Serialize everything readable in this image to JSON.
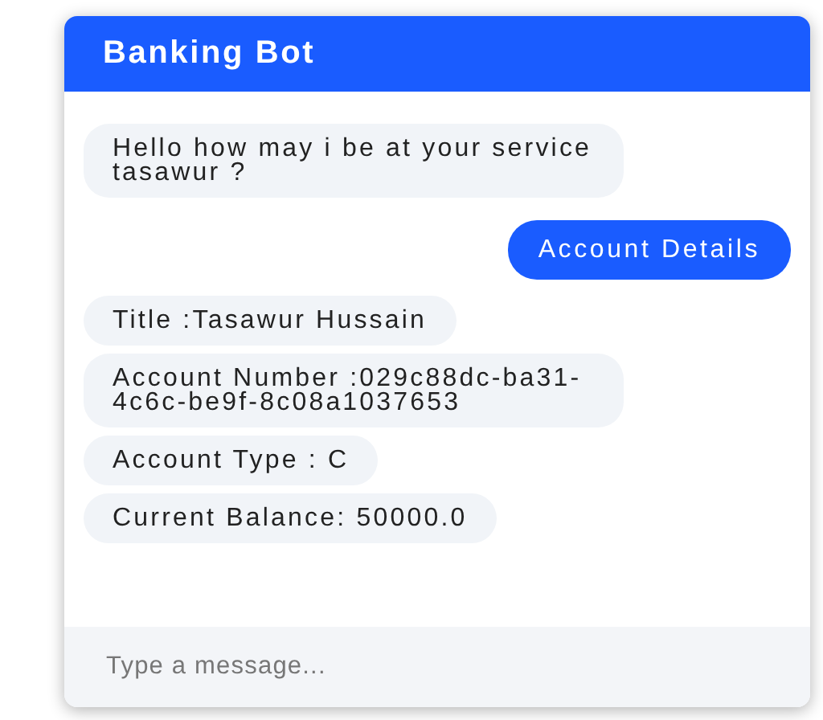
{
  "window": {
    "title": "Banking Bot"
  },
  "messages": [
    {
      "kind": "bot",
      "text": "Hello how may i be at your service tasawur ?"
    },
    {
      "kind": "user",
      "text": "Account Details"
    },
    {
      "kind": "bot",
      "text": "Title :Tasawur Hussain"
    },
    {
      "kind": "bot",
      "text": "Account Number :029c88dc-ba31-4c6c-be9f-8c08a1037653"
    },
    {
      "kind": "bot",
      "text": "Account Type : C"
    },
    {
      "kind": "bot",
      "text": "Current Balance: 50000.0"
    }
  ],
  "composer": {
    "placeholder": "Type a message..."
  }
}
